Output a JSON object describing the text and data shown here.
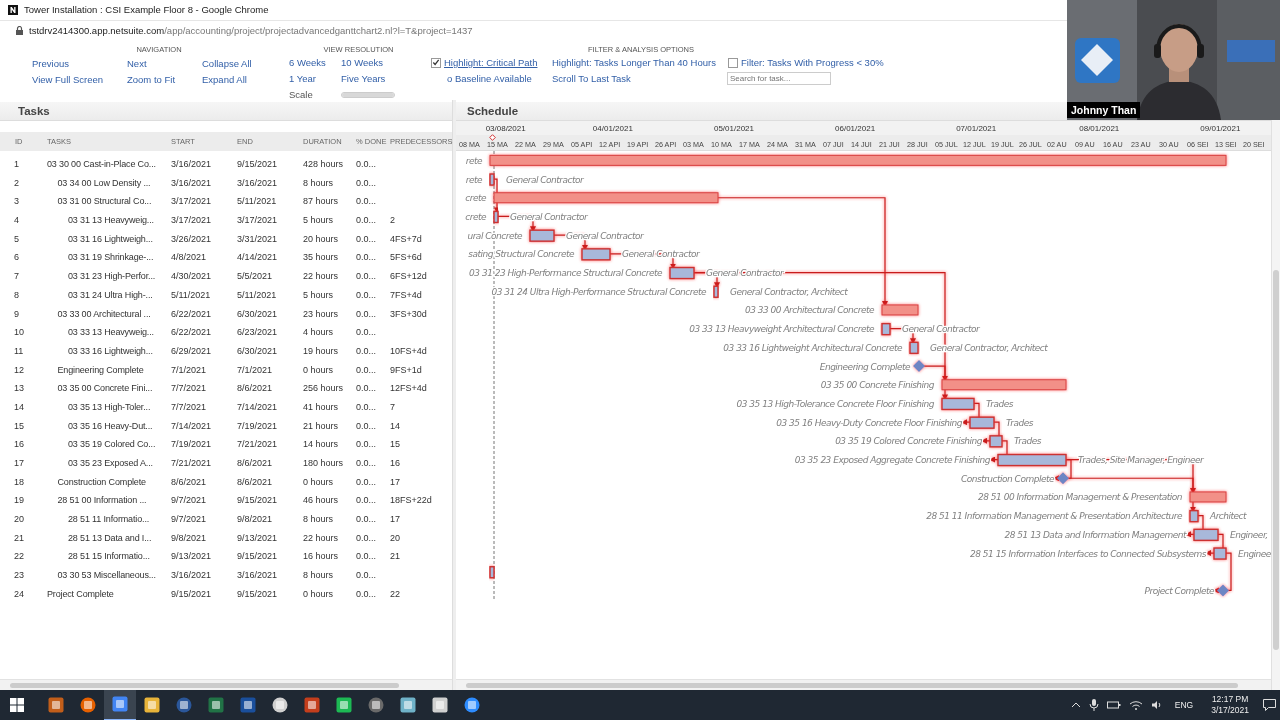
{
  "browser": {
    "title": "Tower Installation : CSI Example Floor 8 - Google Chrome",
    "url_host": "tstdrv2414300.app.netsuite.com",
    "url_path": "/app/accounting/project/projectadvancedganttchart2.nl?l=T&project=1437"
  },
  "toolbar": {
    "navigation": {
      "title": "NAVIGATION",
      "links": [
        "Previous",
        "Next",
        "Collapse All",
        "View Full Screen",
        "Zoom to Fit",
        "Expand All"
      ]
    },
    "view_resolution": {
      "title": "VIEW RESOLUTION",
      "links": [
        "6 Weeks",
        "10 Weeks",
        "1 Year",
        "Five Years"
      ],
      "scale": {
        "label": "Scale",
        "level": 1
      }
    },
    "filter": {
      "title": "FILTER & ANALYSIS OPTIONS",
      "items": [
        {
          "kind": "checkbox",
          "label": "Highlight: Critical Path",
          "checked": true
        },
        {
          "kind": "link",
          "label": "Highlight: Tasks Longer Than 40 Hours"
        },
        {
          "kind": "checkbox",
          "label": "Filter: Tasks With Progress < 30%",
          "checked": false
        },
        {
          "kind": "link",
          "label": "o Baseline Available"
        },
        {
          "kind": "link",
          "label": "Scroll To Last Task"
        },
        {
          "kind": "search",
          "placeholder": "Search for task..."
        }
      ]
    }
  },
  "tasks_panel": {
    "title": "Tasks",
    "columns": [
      "ID",
      "TASKS",
      "START",
      "END",
      "DURATION",
      "% DONE",
      "PREDECESSORS"
    ],
    "rows": [
      {
        "id": "1",
        "task": "03 30 00 Cast-in-Place Co...",
        "start": "3/16/2021",
        "end": "9/15/2021",
        "duration": "428 hours",
        "done": "0.0...",
        "kind": "summary",
        "bar_label": "rete",
        "children": [
          {
            "id": "2",
            "task": "03 34 00 Low Density ...",
            "start": "3/16/2021",
            "end": "3/16/2021",
            "duration": "8 hours",
            "done": "0.0...",
            "kind": "task",
            "bar_label": "rete",
            "resource": "General Contractor"
          },
          {
            "id": "3",
            "task": "03 31 00 Structural Co...",
            "start": "3/17/2021",
            "end": "5/11/2021",
            "duration": "87 hours",
            "done": "0.0...",
            "kind": "summary",
            "bar_label": "crete",
            "children": [
              {
                "id": "4",
                "task": "03 31 13 Heavyweig...",
                "start": "3/17/2021",
                "end": "3/17/2021",
                "duration": "5 hours",
                "done": "0.0...",
                "predecessors": "2",
                "kind": "task",
                "bar_label": "crete",
                "resource": "General Contractor"
              },
              {
                "id": "5",
                "task": "03 31 16 Lightweigh...",
                "start": "3/26/2021",
                "end": "3/31/2021",
                "duration": "20 hours",
                "done": "0.0...",
                "predecessors": "4FS+7d",
                "kind": "task",
                "bar_label": "ural Concrete",
                "resource": "General Contractor"
              },
              {
                "id": "6",
                "task": "03 31 19 Shrinkage-...",
                "start": "4/8/2021",
                "end": "4/14/2021",
                "duration": "35 hours",
                "done": "0.0...",
                "predecessors": "5FS+6d",
                "kind": "task",
                "bar_label": "sating Structural Concrete",
                "resource": "General Contractor"
              },
              {
                "id": "7",
                "task": "03 31 23 High-Perfor...",
                "start": "4/30/2021",
                "end": "5/5/2021",
                "duration": "22 hours",
                "done": "0.0...",
                "predecessors": "6FS+12d",
                "kind": "task",
                "bar_label": "03 31 23 High-Performance Structural Concrete",
                "resource": "General Contractor"
              },
              {
                "id": "8",
                "task": "03 31 24 Ultra High-...",
                "start": "5/11/2021",
                "end": "5/11/2021",
                "duration": "5 hours",
                "done": "0.0...",
                "predecessors": "7FS+4d",
                "kind": "task",
                "bar_label": "03 31 24 Ultra High-Performance Structural Concrete",
                "resource": "General Contractor, Architect"
              }
            ]
          },
          {
            "id": "9",
            "task": "03 33 00 Architectural ...",
            "start": "6/22/2021",
            "end": "6/30/2021",
            "duration": "23 hours",
            "done": "0.0...",
            "predecessors": "3FS+30d",
            "kind": "summary",
            "bar_label": "03 33 00 Architectural Concrete",
            "children": [
              {
                "id": "10",
                "task": "03 33 13 Heavyweig...",
                "start": "6/22/2021",
                "end": "6/23/2021",
                "duration": "4 hours",
                "done": "0.0...",
                "kind": "task",
                "bar_label": "03 33 13 Heavyweight Architectural Concrete",
                "resource": "General Contractor"
              },
              {
                "id": "11",
                "task": "03 33 16 Lightweigh...",
                "start": "6/29/2021",
                "end": "6/30/2021",
                "duration": "19 hours",
                "done": "0.0...",
                "predecessors": "10FS+4d",
                "kind": "task",
                "bar_label": "03 33 16 Lightweight Architectural Concrete",
                "resource": "General Contractor, Architect"
              }
            ]
          },
          {
            "id": "12",
            "task": "Engineering Complete",
            "start": "7/1/2021",
            "end": "7/1/2021",
            "duration": "0 hours",
            "done": "0.0...",
            "predecessors": "9FS+1d",
            "kind": "milestone",
            "bar_label": "Engineering Complete"
          },
          {
            "id": "13",
            "task": "03 35 00 Concrete Fini...",
            "start": "7/7/2021",
            "end": "8/6/2021",
            "duration": "256 hours",
            "done": "0.0...",
            "predecessors": "12FS+4d",
            "kind": "summary",
            "bar_label": "03 35 00 Concrete Finishing",
            "children": [
              {
                "id": "14",
                "task": "03 35 13 High-Toler...",
                "start": "7/7/2021",
                "end": "7/14/2021",
                "duration": "41 hours",
                "done": "0.0...",
                "predecessors": "7",
                "kind": "task",
                "bar_label": "03 35 13 High-Tolerance Concrete Floor Finishing",
                "resource": "Trades"
              },
              {
                "id": "15",
                "task": "03 35 16 Heavy-Dut...",
                "start": "7/14/2021",
                "end": "7/19/2021",
                "duration": "21 hours",
                "done": "0.0...",
                "predecessors": "14",
                "kind": "task",
                "bar_label": "03 35 16 Heavy-Duty Concrete Floor Finishing",
                "resource": "Trades"
              },
              {
                "id": "16",
                "task": "03 35 19 Colored Co...",
                "start": "7/19/2021",
                "end": "7/21/2021",
                "duration": "14 hours",
                "done": "0.0...",
                "predecessors": "15",
                "kind": "task",
                "bar_label": "03 35 19 Colored Concrete Finishing",
                "resource": "Trades"
              },
              {
                "id": "17",
                "task": "03 35 23 Exposed A...",
                "start": "7/21/2021",
                "end": "8/6/2021",
                "duration": "180 hours",
                "done": "0.0...",
                "predecessors": "16",
                "kind": "task",
                "bar_label": "03 35 23 Exposed Aggregate Concrete Finishing",
                "resource": "Trades, Site Manager, Engineer"
              }
            ]
          },
          {
            "id": "18",
            "task": "Construction Complete",
            "start": "8/6/2021",
            "end": "8/6/2021",
            "duration": "0 hours",
            "done": "0.0...",
            "predecessors": "17",
            "kind": "milestone",
            "bar_label": "Construction Complete"
          },
          {
            "id": "19",
            "task": "28 51 00 Information ...",
            "start": "9/7/2021",
            "end": "9/15/2021",
            "duration": "46 hours",
            "done": "0.0...",
            "predecessors": "18FS+22d",
            "kind": "summary",
            "bar_label": "28 51 00 Information Management & Presentation",
            "children": [
              {
                "id": "20",
                "task": "28 51 11 Informatio...",
                "start": "9/7/2021",
                "end": "9/8/2021",
                "duration": "8 hours",
                "done": "0.0...",
                "predecessors": "17",
                "kind": "task",
                "bar_label": "28 51 11 Information Management & Presentation Architecture",
                "resource": "Architect"
              },
              {
                "id": "21",
                "task": "28 51 13 Data and I...",
                "start": "9/8/2021",
                "end": "9/13/2021",
                "duration": "22 hours",
                "done": "0.0...",
                "predecessors": "20",
                "kind": "task",
                "bar_label": "28 51 13 Data and Information Management",
                "resource": "Engineer,"
              },
              {
                "id": "22",
                "task": "28 51 15 Informatio...",
                "start": "9/13/2021",
                "end": "9/15/2021",
                "duration": "16 hours",
                "done": "0.0...",
                "predecessors": "21",
                "kind": "task",
                "bar_label": "28 51 15 Information Interfaces to Connected Subsystems",
                "resource": "Enginee"
              }
            ]
          },
          {
            "id": "23",
            "task": "03 30 53 Miscellaneous...",
            "start": "3/16/2021",
            "end": "3/16/2021",
            "duration": "8 hours",
            "done": "0.0...",
            "kind": "task"
          }
        ]
      },
      {
        "id": "24",
        "task": "Project Complete",
        "start": "9/15/2021",
        "end": "9/15/2021",
        "duration": "0 hours",
        "done": "0.0...",
        "predecessors": "22",
        "kind": "milestone",
        "bar_label": "Project Complete"
      }
    ]
  },
  "schedule": {
    "title": "Schedule",
    "months": [
      "03/08/2021",
      "04/01/2021",
      "05/01/2021",
      "06/01/2021",
      "07/01/2021",
      "08/01/2021",
      "09/01/2021"
    ],
    "weeks": [
      "08 MA",
      "15 MA",
      "22 MA",
      "29 MA",
      "05 API",
      "12 API",
      "19 API",
      "26 API",
      "03 MA",
      "10 MA",
      "17 MA",
      "24 MA",
      "31 MA",
      "07 JUI",
      "14 JUI",
      "21 JUI",
      "28 JUI",
      "05 JUL",
      "12 JUL",
      "19 JUL",
      "26 JUL",
      "02 AU",
      "09 AU",
      "16 AU",
      "23 AU",
      "30 AU",
      "06 SEI",
      "13 SEI",
      "20 SEI"
    ]
  },
  "webcam": {
    "name": "Johnny Than"
  },
  "taskbar": {
    "language": "ENG",
    "time": "12:17 PM",
    "date": "3/17/2021"
  }
}
